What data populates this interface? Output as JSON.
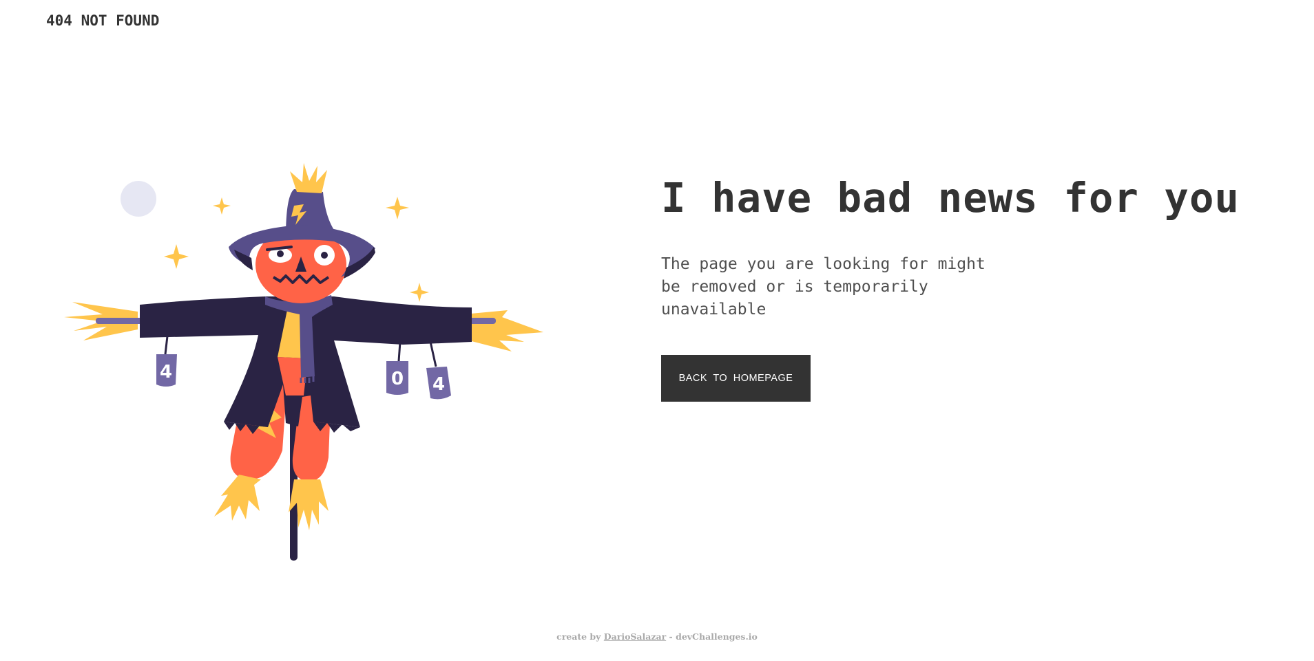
{
  "header": {
    "brand": "404 NOT FOUND"
  },
  "main": {
    "headline": "I have bad news for you",
    "message": "The page you are looking for might be removed or is temporarily unavailable",
    "button_label": "BACK TO HOMEPAGE"
  },
  "illustration": {
    "name": "scarecrow-404",
    "cans": [
      "4",
      "0",
      "4"
    ],
    "colors": {
      "navy": "#2a2344",
      "purple": "#574e8a",
      "can": "#7268a5",
      "orange": "#ff6347",
      "yellow": "#ffc54c",
      "moon": "#e6e7f3"
    }
  },
  "footer": {
    "prefix": "create by",
    "author": "DarioSalazar",
    "separator": "-",
    "site": "devChallenges.io"
  }
}
